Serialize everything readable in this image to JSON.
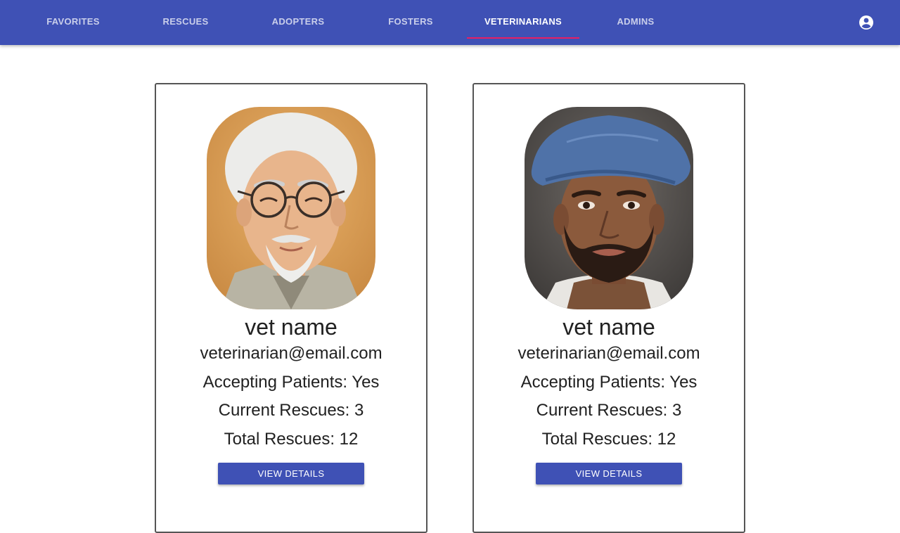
{
  "nav": {
    "tabs": [
      {
        "label": "FAVORITES",
        "active": false
      },
      {
        "label": "RESCUES",
        "active": false
      },
      {
        "label": "ADOPTERS",
        "active": false
      },
      {
        "label": "FOSTERS",
        "active": false
      },
      {
        "label": "VETERINARIANS",
        "active": true
      },
      {
        "label": "ADMINS",
        "active": false
      }
    ],
    "account_icon": "account-circle-icon"
  },
  "colors": {
    "appbar": "#3f51b5",
    "tab_indicator": "#e91e63",
    "button": "#3f51b5"
  },
  "vets": [
    {
      "name": "vet name",
      "email": "veterinarian@email.com",
      "accepting": "Accepting Patients: Yes",
      "current": "Current Rescues: 3",
      "total": "Total Rescues: 12",
      "button_label": "VIEW DETAILS"
    },
    {
      "name": "vet name",
      "email": "veterinarian@email.com",
      "accepting": "Accepting Patients: Yes",
      "current": "Current Rescues: 3",
      "total": "Total Rescues: 12",
      "button_label": "VIEW DETAILS"
    }
  ]
}
